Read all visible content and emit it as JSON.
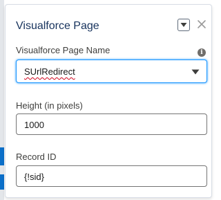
{
  "panel": {
    "title": "Visualforce Page",
    "menu_icon": "chevron-down-icon",
    "close_icon": "close-icon"
  },
  "fields": {
    "page_name": {
      "label": "Visualforce Page Name",
      "info_icon": "info-icon",
      "selected_value": "SUrlRedirect"
    },
    "height": {
      "label": "Height (in pixels)",
      "value": "1000"
    },
    "record_id": {
      "label": "Record ID",
      "value": "{!sid}"
    }
  },
  "colors": {
    "title": "#16325c",
    "focus_border": "#1b96ff",
    "spellcheck_underline": "#d0021b",
    "background_accent": "#0b6fc9"
  }
}
